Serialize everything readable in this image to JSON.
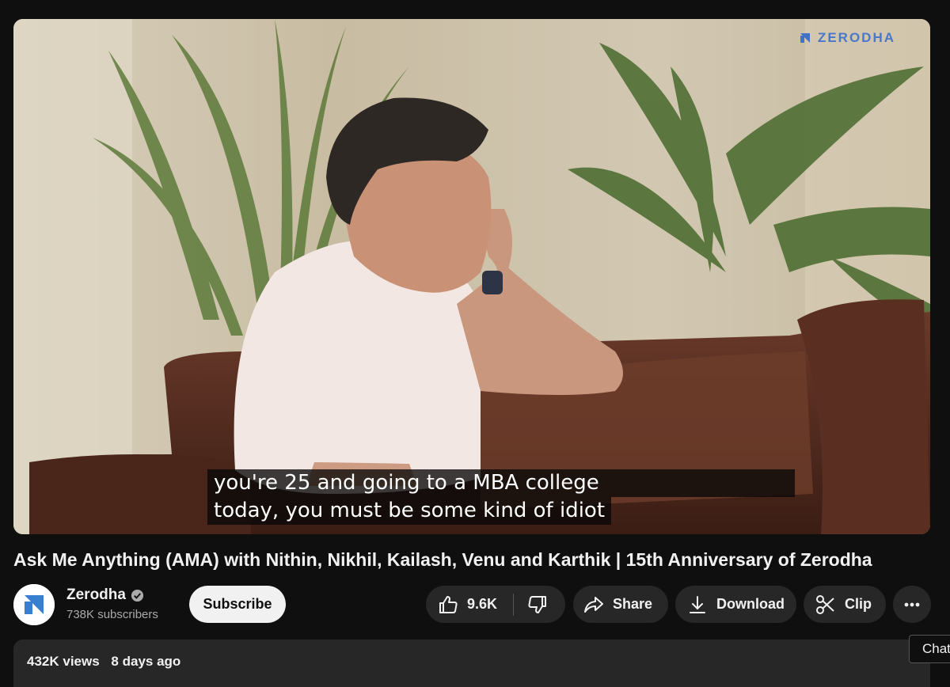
{
  "player": {
    "watermark": "ZERODHA",
    "caption_lines": [
      "you're 25 and going to a MBA college",
      "today, you must be some kind of idiot"
    ]
  },
  "video": {
    "title": "Ask Me Anything (AMA) with Nithin, Nikhil, Kailash, Venu and Karthik | 15th Anniversary of Zerodha"
  },
  "channel": {
    "name": "Zerodha",
    "subscribers": "738K subscribers",
    "subscribe_label": "Subscribe"
  },
  "actions": {
    "like_count": "9.6K",
    "share_label": "Share",
    "download_label": "Download",
    "clip_label": "Clip"
  },
  "description": {
    "views": "432K views",
    "published": "8 days ago"
  },
  "chat_tab": "Chat",
  "colors": {
    "background": "#0f0f0f",
    "pill": "#272727",
    "subscribe_bg": "#f1f1f1",
    "brand_blue": "#387ed1"
  }
}
